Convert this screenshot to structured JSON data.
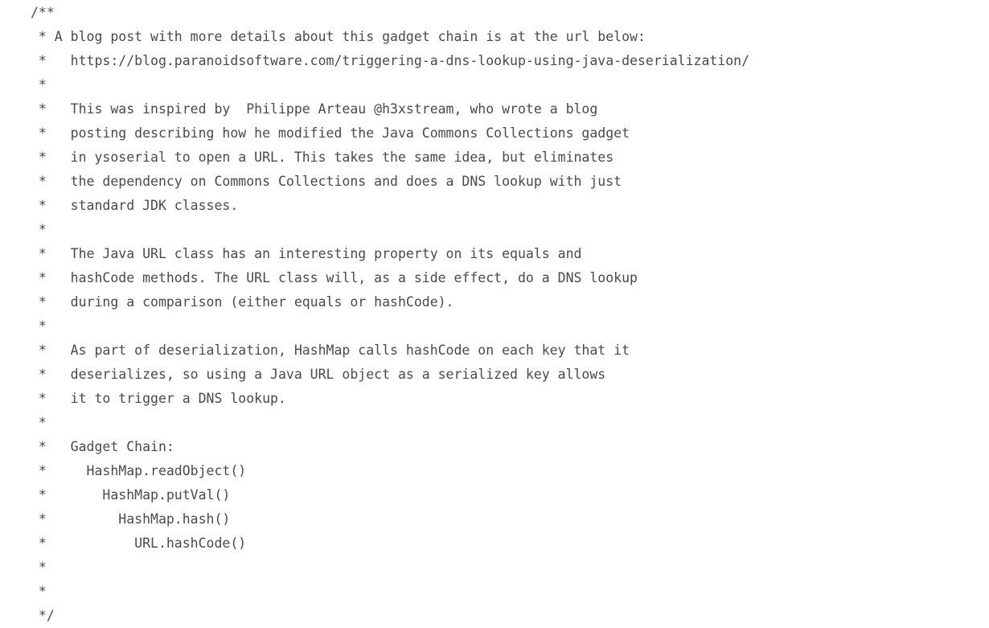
{
  "code": {
    "lines": [
      "/**",
      " * A blog post with more details about this gadget chain is at the url below:",
      " *   https://blog.paranoidsoftware.com/triggering-a-dns-lookup-using-java-deserialization/",
      " *",
      " *   This was inspired by  Philippe Arteau @h3xstream, who wrote a blog",
      " *   posting describing how he modified the Java Commons Collections gadget",
      " *   in ysoserial to open a URL. This takes the same idea, but eliminates",
      " *   the dependency on Commons Collections and does a DNS lookup with just",
      " *   standard JDK classes.",
      " *",
      " *   The Java URL class has an interesting property on its equals and",
      " *   hashCode methods. The URL class will, as a side effect, do a DNS lookup",
      " *   during a comparison (either equals or hashCode).",
      " *",
      " *   As part of deserialization, HashMap calls hashCode on each key that it",
      " *   deserializes, so using a Java URL object as a serialized key allows",
      " *   it to trigger a DNS lookup.",
      " *",
      " *   Gadget Chain:",
      " *     HashMap.readObject()",
      " *       HashMap.putVal()",
      " *         HashMap.hash()",
      " *           URL.hashCode()",
      " *",
      " *",
      " */"
    ]
  }
}
